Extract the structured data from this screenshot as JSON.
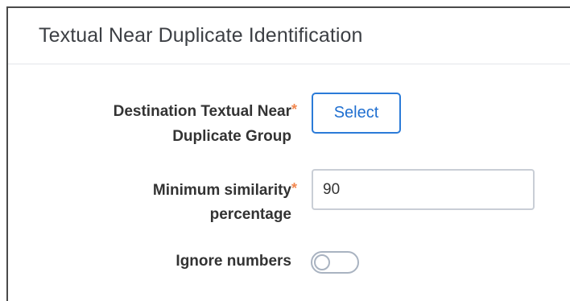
{
  "panel": {
    "title": "Textual Near Duplicate Identification"
  },
  "form": {
    "destination_group": {
      "label_line1": "Destination Textual Near",
      "label_line2": "Duplicate Group",
      "required_mark": "*",
      "button_label": "Select"
    },
    "minimum_similarity": {
      "label_line1": "Minimum similarity",
      "label_line2": "percentage",
      "required_mark": "*",
      "value": "90"
    },
    "ignore_numbers": {
      "label": "Ignore numbers",
      "enabled": false
    }
  },
  "colors": {
    "accent": "#2b7bd8",
    "required": "#f2874f",
    "toggle_border": "#a9b3c1"
  }
}
